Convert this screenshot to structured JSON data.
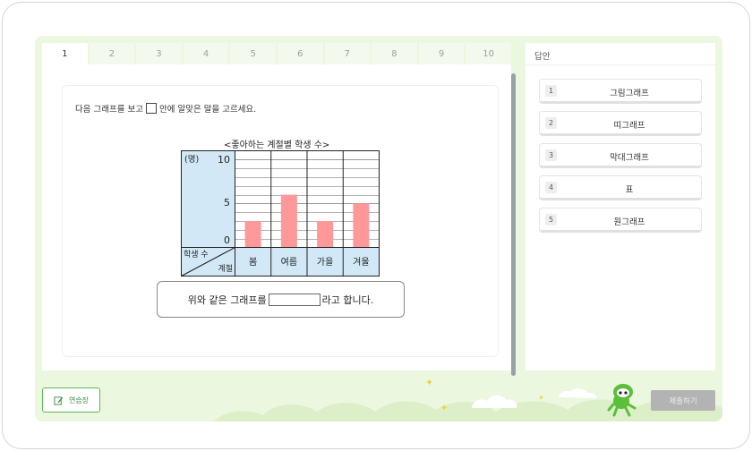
{
  "tabs": [
    "1",
    "2",
    "3",
    "4",
    "5",
    "6",
    "7",
    "8",
    "9",
    "10"
  ],
  "question": {
    "prompt_before": "다음 그래프를 보고",
    "prompt_after": "안에 알맞은 말을 고르세요.",
    "sentence_before": "위와 같은 그래프를",
    "sentence_after": "라고 합니다."
  },
  "chart_data": {
    "type": "bar",
    "title": "<좋아하는 계절별 학생 수>",
    "unit_label": "(명)",
    "row_label": "학생 수",
    "col_label": "계절",
    "categories": [
      "봄",
      "여름",
      "가을",
      "겨울"
    ],
    "values": [
      3,
      6,
      3,
      5
    ],
    "ylim": [
      0,
      10
    ],
    "y_ticks": [
      "10",
      "5",
      "0"
    ],
    "bar_color": "#ff9999",
    "header_color": "#d2e8f6"
  },
  "answers": {
    "title": "답안",
    "options": [
      {
        "num": "1",
        "label": "그림그래프"
      },
      {
        "num": "2",
        "label": "띠그래프"
      },
      {
        "num": "3",
        "label": "막대그래프"
      },
      {
        "num": "4",
        "label": "표"
      },
      {
        "num": "5",
        "label": "원그래프"
      }
    ]
  },
  "footer": {
    "memo_label": "연습장",
    "submit_label": "제출하기"
  }
}
